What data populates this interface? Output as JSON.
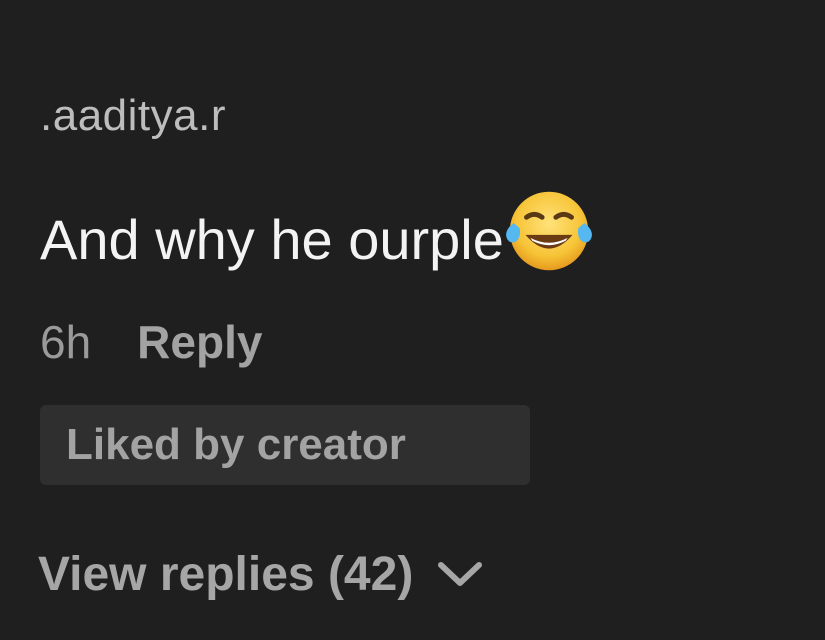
{
  "comment": {
    "username": ".aaditya.r",
    "text": "And why he ourple",
    "emoji": "face-with-tears-of-joy-icon",
    "timestamp": "6h",
    "reply_label": "Reply",
    "badge_label": "Liked by creator",
    "view_replies_label": "View replies (42)"
  },
  "colors": {
    "background": "#1f1f1f",
    "primary_text": "#f3f3f3",
    "secondary_text": "#a3a3a3",
    "badge_background": "#2f2f2f"
  }
}
